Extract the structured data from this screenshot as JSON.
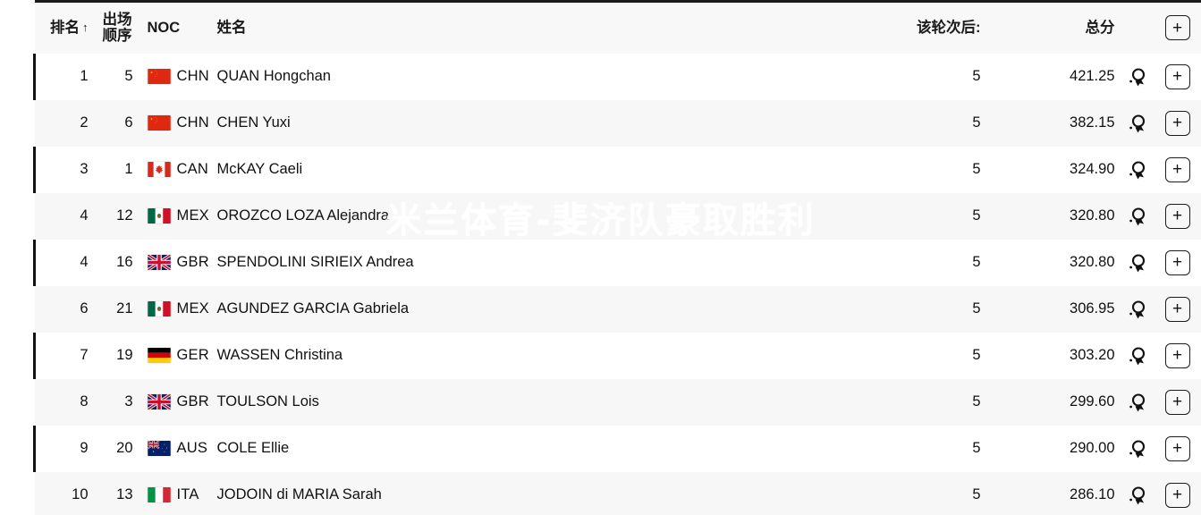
{
  "table": {
    "columns": {
      "rank": "排名",
      "rank_sort_arrow": "↑",
      "order_line1": "出场",
      "order_line2": "顺序",
      "noc": "NOC",
      "name": "姓名",
      "after_round": "该轮次后:",
      "total": "总分",
      "add_button": "+"
    },
    "header_add_label": "+",
    "rows": [
      {
        "rank": "1",
        "order": "5",
        "noc": "CHN",
        "flag": "flag-cn",
        "name": "QUAN Hongchan",
        "after": "5",
        "total": "421.25",
        "medal": "medal-icon",
        "add": "+"
      },
      {
        "rank": "2",
        "order": "6",
        "noc": "CHN",
        "flag": "flag-cn",
        "name": "CHEN Yuxi",
        "after": "5",
        "total": "382.15",
        "medal": "medal-icon",
        "add": "+"
      },
      {
        "rank": "3",
        "order": "1",
        "noc": "CAN",
        "flag": "flag-ca",
        "name": "McKAY Caeli",
        "after": "5",
        "total": "324.90",
        "medal": "medal-icon",
        "add": "+"
      },
      {
        "rank": "4",
        "order": "12",
        "noc": "MEX",
        "flag": "flag-mx",
        "name": "OROZCO LOZA Alejandra",
        "after": "5",
        "total": "320.80",
        "medal": "medal-icon",
        "add": "+"
      },
      {
        "rank": "4",
        "order": "16",
        "noc": "GBR",
        "flag": "flag-gb",
        "name": "SPENDOLINI SIRIEIX Andrea",
        "after": "5",
        "total": "320.80",
        "medal": "medal-icon",
        "add": "+"
      },
      {
        "rank": "6",
        "order": "21",
        "noc": "MEX",
        "flag": "flag-mx",
        "name": "AGUNDEZ GARCIA Gabriela",
        "after": "5",
        "total": "306.95",
        "medal": "medal-icon",
        "add": "+"
      },
      {
        "rank": "7",
        "order": "19",
        "noc": "GER",
        "flag": "flag-de",
        "name": "WASSEN Christina",
        "after": "5",
        "total": "303.20",
        "medal": "medal-icon",
        "add": "+"
      },
      {
        "rank": "8",
        "order": "3",
        "noc": "GBR",
        "flag": "flag-gb",
        "name": "TOULSON Lois",
        "after": "5",
        "total": "299.60",
        "medal": "medal-icon",
        "add": "+"
      },
      {
        "rank": "9",
        "order": "20",
        "noc": "AUS",
        "flag": "flag-au",
        "name": "COLE Ellie",
        "after": "5",
        "total": "290.00",
        "medal": "medal-icon",
        "add": "+"
      },
      {
        "rank": "10",
        "order": "13",
        "noc": "ITA",
        "flag": "flag-it",
        "name": "JODOIN di MARIA Sarah",
        "after": "5",
        "total": "286.10",
        "medal": "medal-icon",
        "add": "+"
      }
    ]
  },
  "watermark": {
    "text": "米兰体育-斐济队豪取胜利",
    "color": "#ffffff"
  },
  "colors": {
    "row_odd": "#ffffff",
    "row_even": "#f7f7f7",
    "header_bg": "#f8f8f8",
    "accent_bar": "#121212",
    "text": "#111111"
  }
}
